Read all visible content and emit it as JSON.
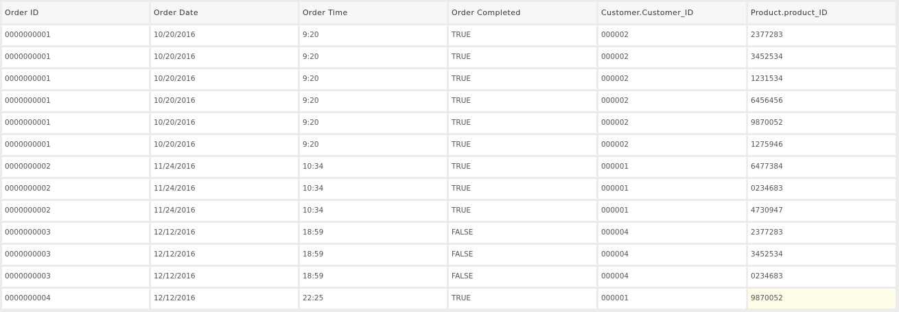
{
  "table": {
    "columns": [
      "Order ID",
      "Order Date",
      "Order Time",
      "Order Completed",
      "Customer.Customer_ID",
      "Product.product_ID"
    ],
    "rows": [
      [
        "0000000001",
        "10/20/2016",
        "9:20",
        "TRUE",
        "000002",
        "2377283"
      ],
      [
        "0000000001",
        "10/20/2016",
        "9:20",
        "TRUE",
        "000002",
        "3452534"
      ],
      [
        "0000000001",
        "10/20/2016",
        "9:20",
        "TRUE",
        "000002",
        "1231534"
      ],
      [
        "0000000001",
        "10/20/2016",
        "9:20",
        "TRUE",
        "000002",
        "6456456"
      ],
      [
        "0000000001",
        "10/20/2016",
        "9:20",
        "TRUE",
        "000002",
        "9870052"
      ],
      [
        "0000000001",
        "10/20/2016",
        "9:20",
        "TRUE",
        "000002",
        "1275946"
      ],
      [
        "0000000002",
        "11/24/2016",
        "10:34",
        "TRUE",
        "000001",
        "6477384"
      ],
      [
        "0000000002",
        "11/24/2016",
        "10:34",
        "TRUE",
        "000001",
        "0234683"
      ],
      [
        "0000000002",
        "11/24/2016",
        "10:34",
        "TRUE",
        "000001",
        "4730947"
      ],
      [
        "0000000003",
        "12/12/2016",
        "18:59",
        "FALSE",
        "000004",
        "2377283"
      ],
      [
        "0000000003",
        "12/12/2016",
        "18:59",
        "FALSE",
        "000004",
        "3452534"
      ],
      [
        "0000000003",
        "12/12/2016",
        "18:59",
        "FALSE",
        "000004",
        "0234683"
      ],
      [
        "0000000004",
        "12/12/2016",
        "22:25",
        "TRUE",
        "000001",
        "9870052"
      ]
    ],
    "highlight_cell": {
      "row": 12,
      "col": 5,
      "color": "#fdfde8"
    }
  }
}
